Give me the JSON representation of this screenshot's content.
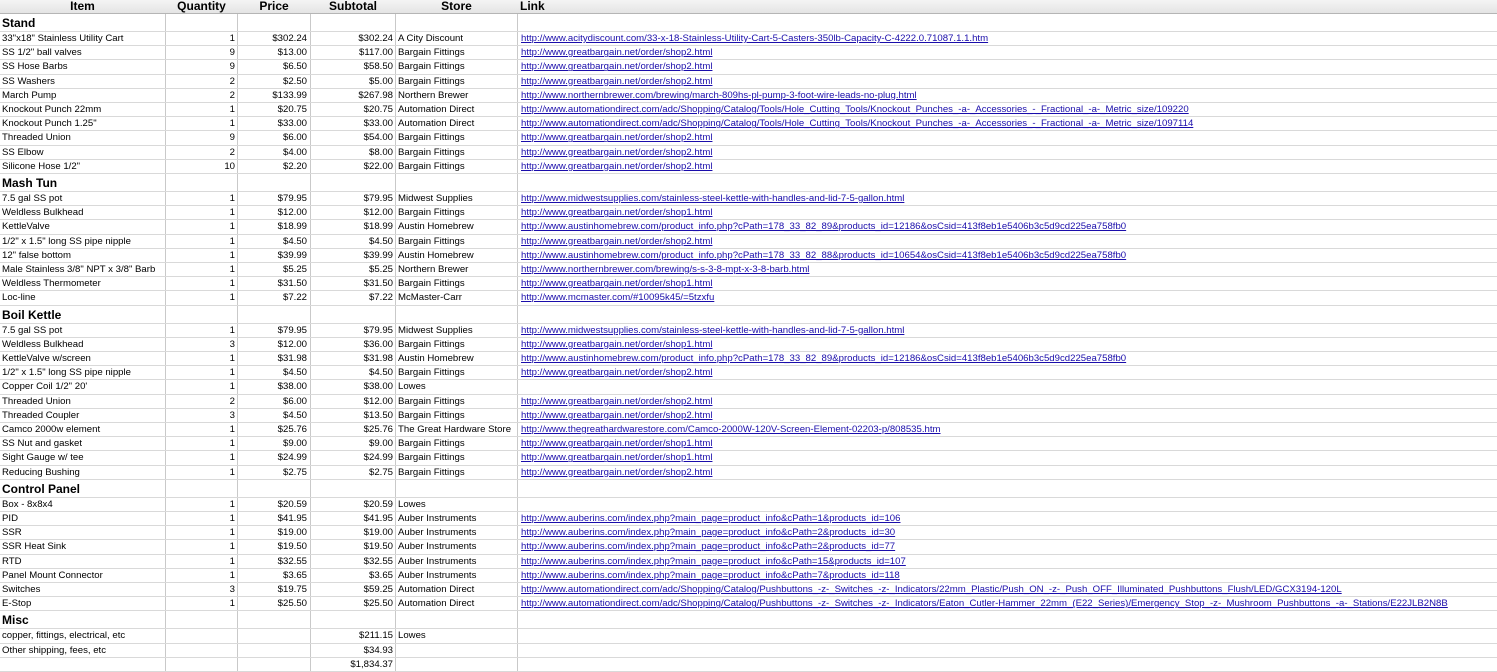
{
  "columns": [
    "Item",
    "Quantity",
    "Price",
    "Subtotal",
    "Store",
    "Link"
  ],
  "rows": [
    {
      "type": "section",
      "label": "Stand"
    },
    {
      "item": "33\"x18\" Stainless Utility Cart",
      "qty": "1",
      "price": "$302.24",
      "subtotal": "$302.24",
      "store": "A City Discount",
      "link": "http://www.acitydiscount.com/33-x-18-Stainless-Utility-Cart-5-Casters-350lb-Capacity-C-4222.0.71087.1.1.htm"
    },
    {
      "item": "SS 1/2\" ball valves",
      "qty": "9",
      "price": "$13.00",
      "subtotal": "$117.00",
      "store": "Bargain Fittings",
      "link": "http://www.greatbargain.net/order/shop2.html"
    },
    {
      "item": "SS Hose Barbs",
      "qty": "9",
      "price": "$6.50",
      "subtotal": "$58.50",
      "store": "Bargain Fittings",
      "link": "http://www.greatbargain.net/order/shop2.html"
    },
    {
      "item": "SS Washers",
      "qty": "2",
      "price": "$2.50",
      "subtotal": "$5.00",
      "store": "Bargain Fittings",
      "link": "http://www.greatbargain.net/order/shop2.html"
    },
    {
      "item": "March Pump",
      "qty": "2",
      "price": "$133.99",
      "subtotal": "$267.98",
      "store": "Northern Brewer",
      "link": "http://www.northernbrewer.com/brewing/march-809hs-pl-pump-3-foot-wire-leads-no-plug.html"
    },
    {
      "item": "Knockout Punch 22mm",
      "qty": "1",
      "price": "$20.75",
      "subtotal": "$20.75",
      "store": "Automation Direct",
      "link": "http://www.automationdirect.com/adc/Shopping/Catalog/Tools/Hole_Cutting_Tools/Knockout_Punches_-a-_Accessories_-_Fractional_-a-_Metric_size/109220"
    },
    {
      "item": "Knockout Punch 1.25\"",
      "qty": "1",
      "price": "$33.00",
      "subtotal": "$33.00",
      "store": "Automation Direct",
      "link": "http://www.automationdirect.com/adc/Shopping/Catalog/Tools/Hole_Cutting_Tools/Knockout_Punches_-a-_Accessories_-_Fractional_-a-_Metric_size/1097114"
    },
    {
      "item": "Threaded Union",
      "qty": "9",
      "price": "$6.00",
      "subtotal": "$54.00",
      "store": "Bargain Fittings",
      "link": "http://www.greatbargain.net/order/shop2.html"
    },
    {
      "item": "SS Elbow",
      "qty": "2",
      "price": "$4.00",
      "subtotal": "$8.00",
      "store": "Bargain Fittings",
      "link": "http://www.greatbargain.net/order/shop2.html"
    },
    {
      "item": "Silicone Hose 1/2\"",
      "qty": "10",
      "price": "$2.20",
      "subtotal": "$22.00",
      "store": "Bargain Fittings",
      "link": "http://www.greatbargain.net/order/shop2.html"
    },
    {
      "type": "section",
      "label": "Mash Tun"
    },
    {
      "item": "7.5 gal SS pot",
      "qty": "1",
      "price": "$79.95",
      "subtotal": "$79.95",
      "store": "Midwest Supplies",
      "link": "http://www.midwestsupplies.com/stainless-steel-kettle-with-handles-and-lid-7-5-gallon.html"
    },
    {
      "item": "Weldless Bulkhead",
      "qty": "1",
      "price": "$12.00",
      "subtotal": "$12.00",
      "store": "Bargain Fittings",
      "link": "http://www.greatbargain.net/order/shop1.html"
    },
    {
      "item": "KettleValve",
      "qty": "1",
      "price": "$18.99",
      "subtotal": "$18.99",
      "store": "Austin Homebrew",
      "link": "http://www.austinhomebrew.com/product_info.php?cPath=178_33_82_89&products_id=12186&osCsid=413f8eb1e5406b3c5d9cd225ea758fb0"
    },
    {
      "item": "1/2\" x 1.5\" long SS pipe nipple",
      "qty": "1",
      "price": "$4.50",
      "subtotal": "$4.50",
      "store": "Bargain Fittings",
      "link": "http://www.greatbargain.net/order/shop2.html"
    },
    {
      "item": "12\" false bottom",
      "qty": "1",
      "price": "$39.99",
      "subtotal": "$39.99",
      "store": "Austin Homebrew",
      "link": "http://www.austinhomebrew.com/product_info.php?cPath=178_33_82_88&products_id=10654&osCsid=413f8eb1e5406b3c5d9cd225ea758fb0"
    },
    {
      "item": "Male Stainless 3/8\" NPT x 3/8\" Barb",
      "qty": "1",
      "price": "$5.25",
      "subtotal": "$5.25",
      "store": "Northern Brewer",
      "link": "http://www.northernbrewer.com/brewing/s-s-3-8-mpt-x-3-8-barb.html"
    },
    {
      "item": "Weldless Thermometer",
      "qty": "1",
      "price": "$31.50",
      "subtotal": "$31.50",
      "store": "Bargain Fittings",
      "link": "http://www.greatbargain.net/order/shop1.html"
    },
    {
      "item": "Loc-line",
      "qty": "1",
      "price": "$7.22",
      "subtotal": "$7.22",
      "store": "McMaster-Carr",
      "link": "http://www.mcmaster.com/#10095k45/=5tzxfu"
    },
    {
      "type": "section",
      "label": "Boil Kettle"
    },
    {
      "item": "7.5 gal SS pot",
      "qty": "1",
      "price": "$79.95",
      "subtotal": "$79.95",
      "store": "Midwest Supplies",
      "link": "http://www.midwestsupplies.com/stainless-steel-kettle-with-handles-and-lid-7-5-gallon.html"
    },
    {
      "item": "Weldless Bulkhead",
      "qty": "3",
      "price": "$12.00",
      "subtotal": "$36.00",
      "store": "Bargain Fittings",
      "link": "http://www.greatbargain.net/order/shop1.html"
    },
    {
      "item": "KettleValve w/screen",
      "qty": "1",
      "price": "$31.98",
      "subtotal": "$31.98",
      "store": "Austin Homebrew",
      "link": "http://www.austinhomebrew.com/product_info.php?cPath=178_33_82_89&products_id=12186&osCsid=413f8eb1e5406b3c5d9cd225ea758fb0"
    },
    {
      "item": "1/2\" x 1.5\" long SS pipe nipple",
      "qty": "1",
      "price": "$4.50",
      "subtotal": "$4.50",
      "store": "Bargain Fittings",
      "link": "http://www.greatbargain.net/order/shop2.html"
    },
    {
      "item": "Copper Coil 1/2\" 20'",
      "qty": "1",
      "price": "$38.00",
      "subtotal": "$38.00",
      "store": "Lowes",
      "link": ""
    },
    {
      "item": "Threaded Union",
      "qty": "2",
      "price": "$6.00",
      "subtotal": "$12.00",
      "store": "Bargain Fittings",
      "link": "http://www.greatbargain.net/order/shop2.html"
    },
    {
      "item": "Threaded Coupler",
      "qty": "3",
      "price": "$4.50",
      "subtotal": "$13.50",
      "store": "Bargain Fittings",
      "link": "http://www.greatbargain.net/order/shop2.html"
    },
    {
      "item": "Camco 2000w element",
      "qty": "1",
      "price": "$25.76",
      "subtotal": "$25.76",
      "store": "The Great Hardware Store",
      "link": "http://www.thegreathardwarestore.com/Camco-2000W-120V-Screen-Element-02203-p/808535.htm"
    },
    {
      "item": "SS Nut and gasket",
      "qty": "1",
      "price": "$9.00",
      "subtotal": "$9.00",
      "store": "Bargain Fittings",
      "link": "http://www.greatbargain.net/order/shop1.html"
    },
    {
      "item": "Sight Gauge w/ tee",
      "qty": "1",
      "price": "$24.99",
      "subtotal": "$24.99",
      "store": "Bargain Fittings",
      "link": "http://www.greatbargain.net/order/shop1.html"
    },
    {
      "item": "Reducing Bushing",
      "qty": "1",
      "price": "$2.75",
      "subtotal": "$2.75",
      "store": "Bargain Fittings",
      "link": "http://www.greatbargain.net/order/shop2.html"
    },
    {
      "type": "section",
      "label": "Control Panel"
    },
    {
      "item": "Box - 8x8x4",
      "qty": "1",
      "price": "$20.59",
      "subtotal": "$20.59",
      "store": "Lowes",
      "link": ""
    },
    {
      "item": "PID",
      "qty": "1",
      "price": "$41.95",
      "subtotal": "$41.95",
      "store": "Auber Instruments",
      "link": "http://www.auberins.com/index.php?main_page=product_info&cPath=1&products_id=106"
    },
    {
      "item": "SSR",
      "qty": "1",
      "price": "$19.00",
      "subtotal": "$19.00",
      "store": "Auber Instruments",
      "link": "http://www.auberins.com/index.php?main_page=product_info&cPath=2&products_id=30"
    },
    {
      "item": "SSR Heat Sink",
      "qty": "1",
      "price": "$19.50",
      "subtotal": "$19.50",
      "store": "Auber Instruments",
      "link": "http://www.auberins.com/index.php?main_page=product_info&cPath=2&products_id=77"
    },
    {
      "item": "RTD",
      "qty": "1",
      "price": "$32.55",
      "subtotal": "$32.55",
      "store": "Auber Instruments",
      "link": "http://www.auberins.com/index.php?main_page=product_info&cPath=15&products_id=107"
    },
    {
      "item": "Panel Mount Connector",
      "qty": "1",
      "price": "$3.65",
      "subtotal": "$3.65",
      "store": "Auber Instruments",
      "link": "http://www.auberins.com/index.php?main_page=product_info&cPath=7&products_id=118"
    },
    {
      "item": "Switches",
      "qty": "3",
      "price": "$19.75",
      "subtotal": "$59.25",
      "store": "Automation Direct",
      "link": "http://www.automationdirect.com/adc/Shopping/Catalog/Pushbuttons_-z-_Switches_-z-_Indicators/22mm_Plastic/Push_ON_-z-_Push_OFF_Illuminated_Pushbuttons_Flush/LED/GCX3194-120L"
    },
    {
      "item": "E-Stop",
      "qty": "1",
      "price": "$25.50",
      "subtotal": "$25.50",
      "store": "Automation Direct",
      "link": "http://www.automationdirect.com/adc/Shopping/Catalog/Pushbuttons_-z-_Switches_-z-_Indicators/Eaton_Cutler-Hammer_22mm_(E22_Series)/Emergency_Stop_-z-_Mushroom_Pushbuttons_-a-_Stations/E22JLB2N8B"
    },
    {
      "type": "section",
      "label": "Misc"
    },
    {
      "item": "copper, fittings, electrical, etc",
      "qty": "",
      "price": "",
      "subtotal": "$211.15",
      "store": "Lowes",
      "link": ""
    },
    {
      "item": "Other shipping, fees, etc",
      "qty": "",
      "price": "",
      "subtotal": "$34.93",
      "store": "",
      "link": ""
    },
    {
      "item": "",
      "qty": "",
      "price": "",
      "subtotal": "$1,834.37",
      "store": "",
      "link": ""
    }
  ]
}
